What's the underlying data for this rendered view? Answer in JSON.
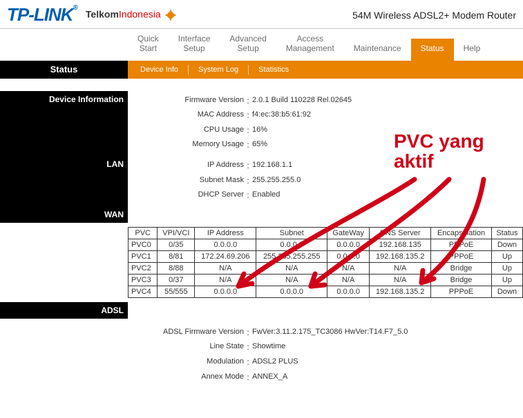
{
  "header": {
    "brand_logo_text": "TP-LINK",
    "reg_mark": "®",
    "partner_logo_prefix": "Telkom",
    "partner_logo_suffix": "Indonesia",
    "product_title": "54M Wireless ADSL2+ Modem Router"
  },
  "nav": {
    "tabs": [
      {
        "label": "Quick\nStart"
      },
      {
        "label": "Interface\nSetup"
      },
      {
        "label": "Advanced\nSetup"
      },
      {
        "label": "Access\nManagement"
      },
      {
        "label": "Maintenance"
      },
      {
        "label": "Status"
      },
      {
        "label": "Help"
      }
    ],
    "active_index": 5,
    "page_title": "Status",
    "subnav": [
      {
        "label": "Device Info"
      },
      {
        "label": "System Log"
      },
      {
        "label": "Statistics"
      }
    ]
  },
  "sections": {
    "device_info": {
      "label": "Device Information",
      "items": [
        {
          "k": "Firmware Version",
          "v": "2.0.1 Build 110228 Rel.02645"
        },
        {
          "k": "MAC Address",
          "v": "f4:ec:38:b5:61:92"
        },
        {
          "k": "CPU Usage",
          "v": "16%"
        },
        {
          "k": "Memory Usage",
          "v": "65%"
        }
      ]
    },
    "lan": {
      "label": "LAN",
      "items": [
        {
          "k": "IP Address",
          "v": "192.168.1.1"
        },
        {
          "k": "Subnet Mask",
          "v": "255.255.255.0"
        },
        {
          "k": "DHCP Server",
          "v": "Enabled"
        }
      ]
    },
    "wan": {
      "label": "WAN",
      "columns": [
        "PVC",
        "VPI/VCI",
        "IP Address",
        "Subnet",
        "GateWay",
        "DNS Server",
        "Encapsulation",
        "Status"
      ],
      "rows": [
        [
          "PVC0",
          "0/35",
          "0.0.0.0",
          "0.0.0.0",
          "0.0.0.0",
          "192.168.135",
          "PPPoE",
          "Down"
        ],
        [
          "PVC1",
          "8/81",
          "172.24.69.206",
          "255.255.255.255",
          "0.0.0.0",
          "192.168.135.2",
          "PPPoE",
          "Up"
        ],
        [
          "PVC2",
          "8/88",
          "N/A",
          "N/A",
          "N/A",
          "N/A",
          "Bridge",
          "Up"
        ],
        [
          "PVC3",
          "0/37",
          "N/A",
          "N/A",
          "N/A",
          "N/A",
          "Bridge",
          "Up"
        ],
        [
          "PVC4",
          "55/555",
          "0.0.0.0",
          "0.0.0.0",
          "0.0.0.0",
          "192.168.135.2",
          "PPPoE",
          "Down"
        ]
      ]
    },
    "adsl": {
      "label": "ADSL",
      "items": [
        {
          "k": "ADSL Firmware Version",
          "v": "FwVer:3.11.2.175_TC3086 HwVer:T14.F7_5.0"
        },
        {
          "k": "Line State",
          "v": "Showtime"
        },
        {
          "k": "Modulation",
          "v": "ADSL2 PLUS"
        },
        {
          "k": "Annex Mode",
          "v": "ANNEX_A"
        }
      ]
    }
  },
  "annotation": {
    "text_line1": "PVC yang",
    "text_line2": "aktif"
  }
}
